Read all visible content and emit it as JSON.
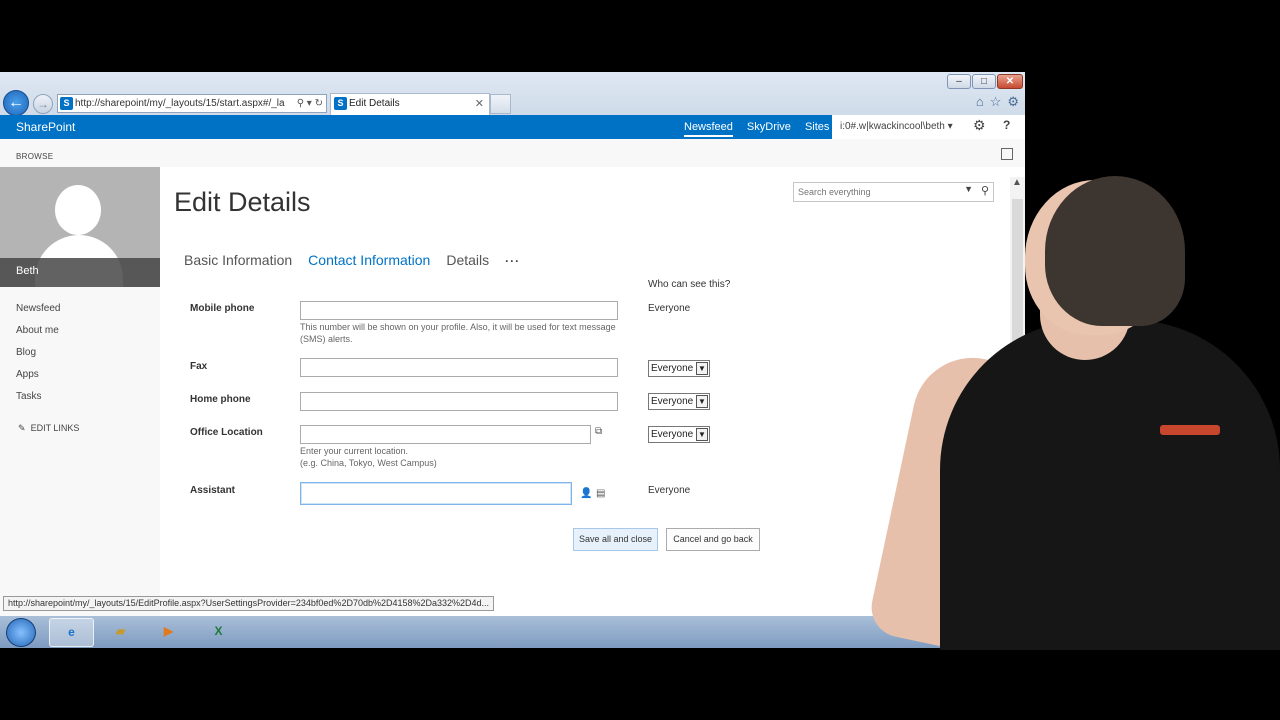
{
  "browser": {
    "address": "http://sharepoint/my/_layouts/15/start.aspx#/_la",
    "tab_title": "Edit Details",
    "status_url": "http://sharepoint/my/_layouts/15/EditProfile.aspx?UserSettingsProvider=234bf0ed%2D70db%2D4158%2Da332%2D4d...",
    "win_min": "–",
    "win_max": "□",
    "win_close": "✕"
  },
  "suite": {
    "brand": "SharePoint",
    "links": [
      "Newsfeed",
      "SkyDrive",
      "Sites"
    ],
    "user": "i:0#.w|kwackincool\\beth ▾"
  },
  "ribbon": {
    "tab": "BROWSE"
  },
  "profile": {
    "name": "Beth"
  },
  "leftnav": {
    "items": [
      "Newsfeed",
      "About me",
      "Blog",
      "Apps",
      "Tasks"
    ],
    "edit_links": "EDIT LINKS"
  },
  "page": {
    "title": "Edit Details"
  },
  "search": {
    "placeholder": "Search everything"
  },
  "pivot": {
    "tabs": [
      "Basic Information",
      "Contact Information",
      "Details"
    ],
    "active": "Contact Information",
    "more": "···"
  },
  "form": {
    "who_can_see": "Who can see this?",
    "fields": [
      {
        "label": "Mobile phone",
        "value": "",
        "help": "This number will be shown on your profile. Also, it will be used for text message (SMS) alerts.",
        "privacy": "Everyone"
      },
      {
        "label": "Fax",
        "value": "",
        "privacy": "Everyone"
      },
      {
        "label": "Home phone",
        "value": "",
        "privacy": "Everyone"
      },
      {
        "label": "Office Location",
        "value": "",
        "help_line1": "Enter your current location.",
        "help_line2": "(e.g. China, Tokyo, West Campus)",
        "privacy": "Everyone"
      },
      {
        "label": "Assistant",
        "value": "",
        "privacy": "Everyone"
      }
    ]
  },
  "buttons": {
    "save": "Save all and close",
    "cancel": "Cancel and go back"
  },
  "colors": {
    "suite_blue": "#0072c6",
    "active_pivot": "#0072c6"
  }
}
